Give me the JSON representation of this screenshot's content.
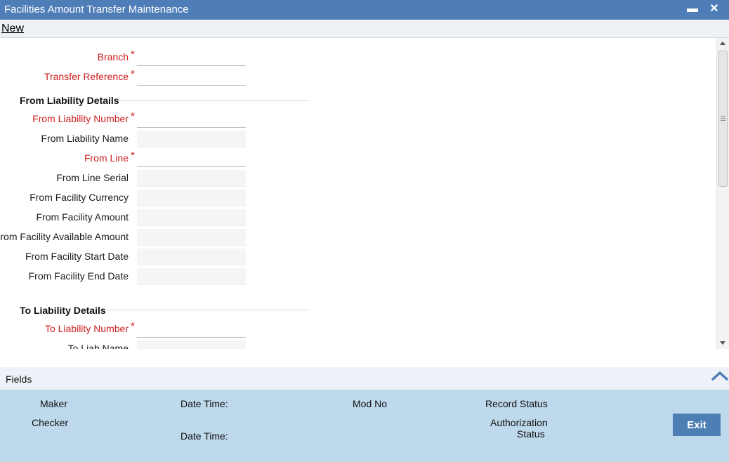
{
  "window": {
    "title": "Facilities Amount Transfer Maintenance",
    "minimize_icon": "minimize-icon",
    "close_icon": "close-icon"
  },
  "menu": {
    "new_label": "New"
  },
  "form": {
    "branch_label": "Branch",
    "transfer_reference_label": "Transfer Reference",
    "required_marker": "*",
    "from_section": "From Liability Details",
    "from_liability_number_label": "From Liability Number",
    "from_liability_name_label": "From Liability Name",
    "from_line_label": "From Line",
    "from_line_serial_label": "From Line Serial",
    "from_facility_currency_label": "From Facility Currency",
    "from_facility_amount_label": "From Facility Amount",
    "from_facility_available_amount_label": "From Facility Available Amount",
    "from_facility_start_date_label": "From Facility Start Date",
    "from_facility_end_date_label": "From Facility End Date",
    "to_section": "To Liability Details",
    "to_liability_number_label": "To Liability Number",
    "to_liab_name_label": "To Liab Name"
  },
  "fields_bar": {
    "label": "Fields",
    "collapse_icon": "chevron-up-icon"
  },
  "footer": {
    "maker_label": "Maker",
    "checker_label": "Checker",
    "date_time_label_1": "Date Time:",
    "date_time_label_2": "Date Time:",
    "mod_no_label": "Mod No",
    "record_status_label": "Record Status",
    "authorization_label": "Authorization",
    "status_label": "Status",
    "exit_label": "Exit"
  },
  "colors": {
    "titlebar": "#4f7db8",
    "required_label": "#cc1f1f",
    "footer_bg": "#bed8ec",
    "exit_button": "#4d7fb5"
  }
}
